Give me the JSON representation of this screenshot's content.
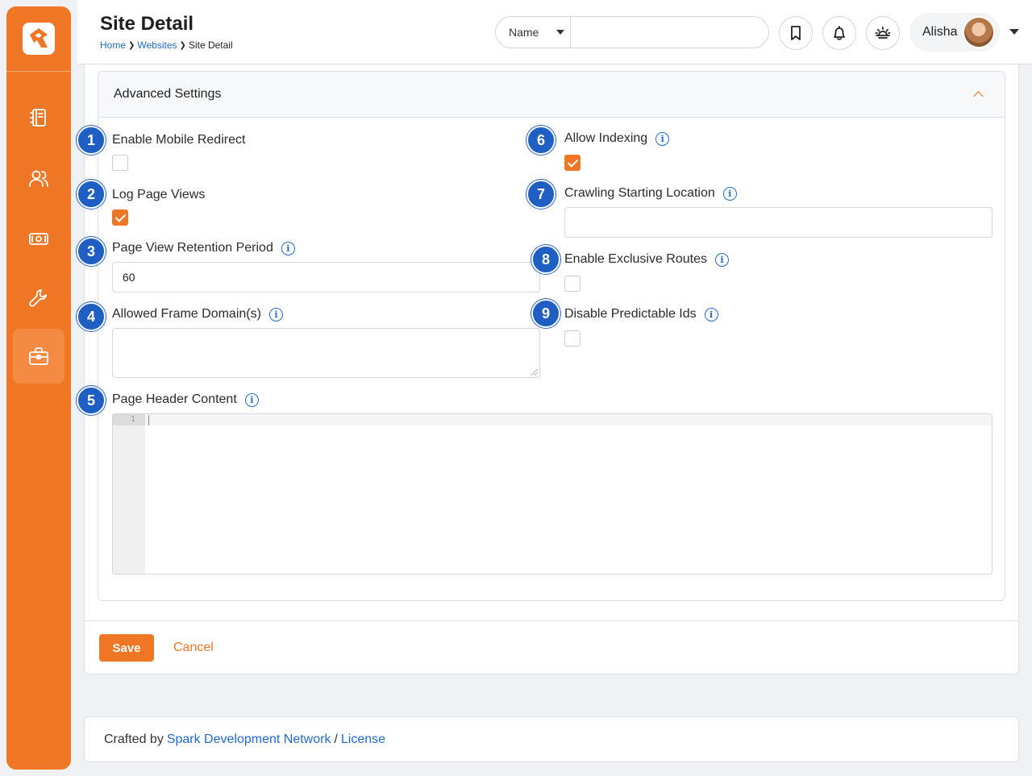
{
  "header": {
    "title": "Site Detail",
    "breadcrumb": [
      "Home",
      "Websites",
      "Site Detail"
    ],
    "search_type": "Name",
    "search_placeholder": "",
    "user_name": "Alisha"
  },
  "sidebar": {
    "items": [
      {
        "icon": "notebook-icon"
      },
      {
        "icon": "people-icon"
      },
      {
        "icon": "money-icon"
      },
      {
        "icon": "wrench-icon"
      },
      {
        "icon": "briefcase-icon",
        "active": true
      }
    ]
  },
  "panel": {
    "title": "Advanced Settings"
  },
  "fields": {
    "enable_mobile_redirect": {
      "label": "Enable Mobile Redirect",
      "badge": "1",
      "checked": false
    },
    "log_page_views": {
      "label": "Log Page Views",
      "badge": "2",
      "checked": true
    },
    "page_view_retention": {
      "label": "Page View Retention Period",
      "badge": "3",
      "value": "60"
    },
    "allowed_frame_domains": {
      "label": "Allowed Frame Domain(s)",
      "badge": "4",
      "value": ""
    },
    "page_header_content": {
      "label": "Page Header Content",
      "badge": "5",
      "line_number": "1"
    },
    "allow_indexing": {
      "label": "Allow Indexing",
      "badge": "6",
      "checked": true
    },
    "crawling_start": {
      "label": "Crawling Starting Location",
      "badge": "7",
      "value": ""
    },
    "enable_exclusive_routes": {
      "label": "Enable Exclusive Routes",
      "badge": "8",
      "checked": false
    },
    "disable_predictable_ids": {
      "label": "Disable Predictable Ids",
      "badge": "9",
      "checked": false
    }
  },
  "actions": {
    "save": "Save",
    "cancel": "Cancel"
  },
  "footer": {
    "prefix": "Crafted by",
    "link1": "Spark Development Network",
    "sep": "/",
    "link2": "License"
  },
  "colors": {
    "accent": "#ee7625",
    "link": "#1f6bd1",
    "badge": "#1f5fc4"
  }
}
